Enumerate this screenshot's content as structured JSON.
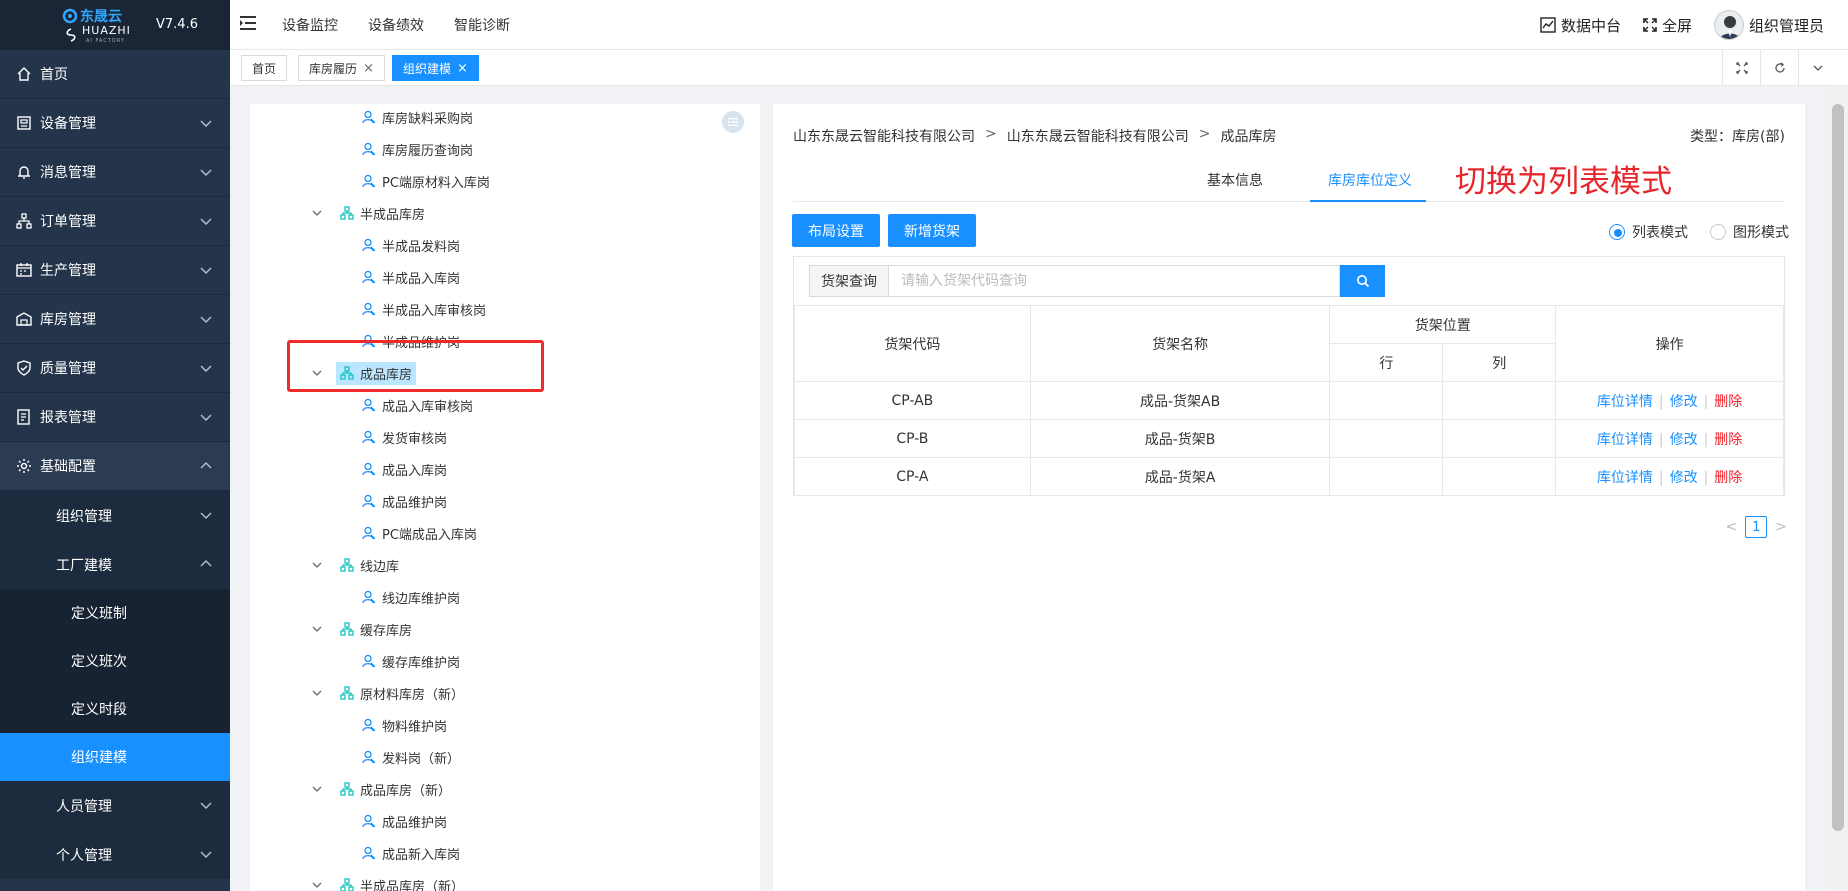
{
  "app": {
    "brand": "东晟云",
    "brand_en": "HUAZHI",
    "brand_tag": "AI FACTORY",
    "version": "V7.4.6"
  },
  "sidebar": {
    "items": [
      {
        "label": "首页",
        "icon": "home-icon"
      },
      {
        "label": "设备管理",
        "icon": "device-icon"
      },
      {
        "label": "消息管理",
        "icon": "bell-icon"
      },
      {
        "label": "订单管理",
        "icon": "order-icon"
      },
      {
        "label": "生产管理",
        "icon": "production-icon"
      },
      {
        "label": "库房管理",
        "icon": "warehouse-icon"
      },
      {
        "label": "质量管理",
        "icon": "shield-icon"
      },
      {
        "label": "报表管理",
        "icon": "report-icon"
      },
      {
        "label": "基础配置",
        "icon": "gear-icon"
      }
    ],
    "sub_items": [
      {
        "label": "组织管理"
      },
      {
        "label": "工厂建模"
      }
    ],
    "subsub_items": [
      {
        "label": "定义班制"
      },
      {
        "label": "定义班次"
      },
      {
        "label": "定义时段"
      },
      {
        "label": "组织建模"
      }
    ],
    "tail_items": [
      {
        "label": "人员管理"
      },
      {
        "label": "个人管理"
      }
    ]
  },
  "header": {
    "nav": [
      "设备监控",
      "设备绩效",
      "智能诊断"
    ],
    "data_center": "数据中台",
    "fullscreen": "全屏",
    "user": "组织管理员"
  },
  "tabs": [
    {
      "label": "首页"
    },
    {
      "label": "库房履历"
    },
    {
      "label": "组织建模"
    }
  ],
  "tree": {
    "nodes": [
      {
        "label": "库房缺料采购岗",
        "type": "post"
      },
      {
        "label": "库房履历查询岗",
        "type": "post"
      },
      {
        "label": "PC端原材料入库岗",
        "type": "post"
      },
      {
        "label": "半成品库房",
        "type": "dept"
      },
      {
        "label": "半成品发料岗",
        "type": "post"
      },
      {
        "label": "半成品入库岗",
        "type": "post"
      },
      {
        "label": "半成品入库审核岗",
        "type": "post"
      },
      {
        "label": "半成品维护岗",
        "type": "post"
      },
      {
        "label": "成品库房",
        "type": "dept"
      },
      {
        "label": "成品入库审核岗",
        "type": "post"
      },
      {
        "label": "发货审核岗",
        "type": "post"
      },
      {
        "label": "成品入库岗",
        "type": "post"
      },
      {
        "label": "成品维护岗",
        "type": "post"
      },
      {
        "label": "PC端成品入库岗",
        "type": "post"
      },
      {
        "label": "线边库",
        "type": "dept"
      },
      {
        "label": "线边库维护岗",
        "type": "post"
      },
      {
        "label": "缓存库房",
        "type": "dept"
      },
      {
        "label": "缓存库维护岗",
        "type": "post"
      },
      {
        "label": "原材料库房（新）",
        "type": "dept"
      },
      {
        "label": "物料维护岗",
        "type": "post"
      },
      {
        "label": "发料岗（新）",
        "type": "post"
      },
      {
        "label": "成品库房（新）",
        "type": "dept"
      },
      {
        "label": "成品维护岗",
        "type": "post"
      },
      {
        "label": "成品新入库岗",
        "type": "post"
      },
      {
        "label": "半成品库房（新）",
        "type": "dept"
      }
    ]
  },
  "detail": {
    "breadcrumb": [
      "山东东晟云智能科技有限公司",
      "山东东晟云智能科技有限公司",
      "成品库房"
    ],
    "type_label": "类型：库房(部)",
    "tabs": [
      "基本信息",
      "库房库位定义"
    ],
    "annotation": "切换为列表模式",
    "buttons": {
      "layout": "布局设置",
      "add_shelf": "新增货架"
    },
    "modes": {
      "list": "列表模式",
      "graph": "图形模式"
    },
    "search": {
      "prefix": "货架查询",
      "placeholder": "请输入货架代码查询"
    },
    "table": {
      "headers": {
        "code": "货架代码",
        "name": "货架名称",
        "position": "货架位置",
        "row": "行",
        "col": "列",
        "ops": "操作"
      },
      "rows": [
        {
          "code": "CP-AB",
          "name": "成品-货架AB",
          "row": "",
          "col": ""
        },
        {
          "code": "CP-B",
          "name": "成品-货架B",
          "row": "",
          "col": ""
        },
        {
          "code": "CP-A",
          "name": "成品-货架A",
          "row": "",
          "col": ""
        }
      ],
      "ops": {
        "detail": "库位详情",
        "edit": "修改",
        "delete": "删除",
        "sep": "|"
      }
    },
    "pager": {
      "current": "1",
      "prev": "<",
      "next": ">"
    }
  },
  "colors": {
    "sidebar_bg": "#24344a",
    "accent": "#1890ff",
    "danger": "#f5222d",
    "annotation": "#e8252a"
  }
}
